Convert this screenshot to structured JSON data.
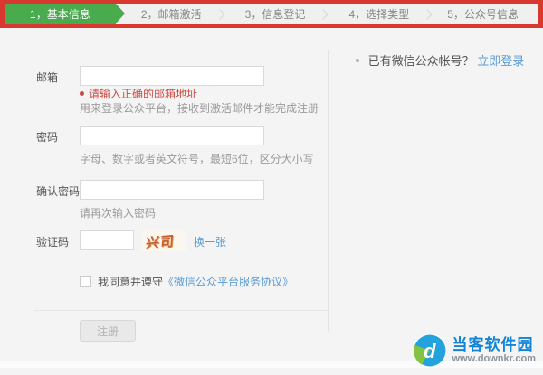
{
  "colors": {
    "accent_green": "#4aaa4e",
    "annotation_red": "#d8382e",
    "link_blue": "#5a9bd3",
    "error_red": "#cc4a42",
    "brand_blue": "#1285d8"
  },
  "stepper": {
    "steps": [
      {
        "label": "1，基本信息",
        "active": true
      },
      {
        "label": "2，邮箱激活",
        "active": false
      },
      {
        "label": "3，信息登记",
        "active": false
      },
      {
        "label": "4，选择类型",
        "active": false
      },
      {
        "label": "5，公众号信息",
        "active": false
      }
    ]
  },
  "form": {
    "email": {
      "label": "邮箱",
      "value": "",
      "error": "请输入正确的邮箱地址",
      "help": "用来登录公众平台，接收到激活邮件才能完成注册"
    },
    "password": {
      "label": "密码",
      "value": "",
      "help": "字母、数字或者英文符号，最短6位，区分大小写"
    },
    "confirm_password": {
      "label": "确认密码",
      "value": "",
      "help": "请再次输入密码"
    },
    "captcha": {
      "label": "验证码",
      "value": "",
      "glyphs": "兴司",
      "refresh_label": "换一张"
    },
    "agreement": {
      "text": "我同意并遵守",
      "link": "《微信公众平台服务协议》"
    },
    "submit_label": "注册"
  },
  "aside": {
    "text": "已有微信公众帐号？",
    "link": "立即登录"
  },
  "watermark": {
    "title": "当客软件园",
    "url": "www.downkr.com"
  }
}
